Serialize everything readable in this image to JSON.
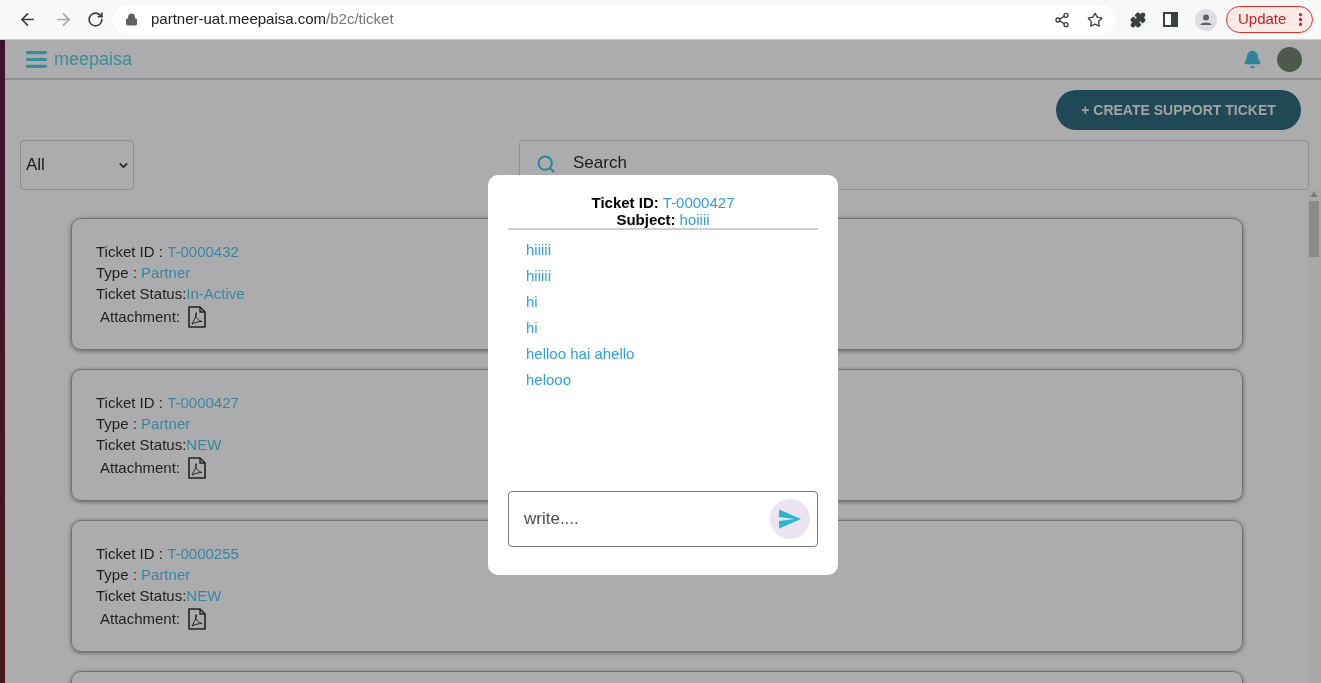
{
  "browser": {
    "back": {
      "disabled": false
    },
    "forward": {
      "disabled": true
    },
    "url": {
      "host": "partner-uat.meepaisa.com",
      "path": "/b2c/ticket"
    },
    "update_button": "Update"
  },
  "navbar": {
    "brand": "meepaisa"
  },
  "create_button": "+ CREATE SUPPORT TICKET",
  "filter": {
    "value": "All"
  },
  "search": {
    "placeholder": "Search"
  },
  "tickets": [
    {
      "fields": [
        {
          "label": "Ticket ID : ",
          "value": "T-0000432"
        },
        {
          "label": "Type : ",
          "value": "Partner"
        },
        {
          "label": "Ticket Status:",
          "value": "In-Active"
        }
      ],
      "attachment_label": "Attachment:"
    },
    {
      "fields": [
        {
          "label": "Ticket ID : ",
          "value": "T-0000427"
        },
        {
          "label": "Type : ",
          "value": "Partner"
        },
        {
          "label": "Ticket Status:",
          "value": "NEW"
        }
      ],
      "attachment_label": "Attachment:"
    },
    {
      "fields": [
        {
          "label": "Ticket ID : ",
          "value": "T-0000255"
        },
        {
          "label": "Type : ",
          "value": "Partner"
        },
        {
          "label": "Ticket Status:",
          "value": "NEW"
        }
      ],
      "attachment_label": "Attachment:"
    }
  ],
  "chat_dialog": {
    "ticket_id_label": "Ticket ID:",
    "ticket_id": "T-0000427",
    "subject_label": "Subject:",
    "subject": "hoiiii",
    "messages": [
      "hiiiii",
      "hiiiii",
      "hi",
      "hi",
      "helloo hai ahello",
      "helooo"
    ],
    "reply": {
      "placeholder": "write...."
    }
  }
}
